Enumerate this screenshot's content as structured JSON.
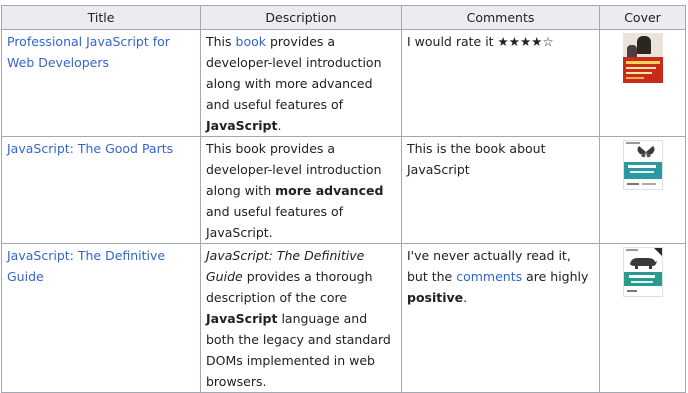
{
  "table": {
    "headers": {
      "title": "Title",
      "description": "Description",
      "comments": "Comments",
      "cover": "Cover"
    },
    "rows": [
      {
        "title": "Professional JavaScript for Web Developers",
        "desc_parts": [
          "This ",
          "book",
          " provides a developer-level introduction along with more advanced and useful features of ",
          "JavaScript",
          "."
        ],
        "comment_parts": [
          "I would rate it ",
          "★★★★☆"
        ],
        "cover_icon": "book-cover-professional-javascript"
      },
      {
        "title": "JavaScript: The Good Parts",
        "desc_parts": [
          "This book provides a developer-level introduction along with ",
          "more advanced",
          " and useful features of JavaScript."
        ],
        "comment": "This is the book about JavaScript",
        "cover_icon": "book-cover-good-parts"
      },
      {
        "title": "JavaScript: The Definitive Guide",
        "desc_parts": [
          "JavaScript: The Definitive Guide",
          " provides a thorough description of the core ",
          "JavaScript",
          " language and both the legacy and standard DOMs implemented in web browsers."
        ],
        "comment_parts": [
          "I've never actually read it, but the ",
          "comments",
          " are highly ",
          "positive",
          "."
        ],
        "cover_icon": "book-cover-definitive-guide"
      }
    ]
  }
}
